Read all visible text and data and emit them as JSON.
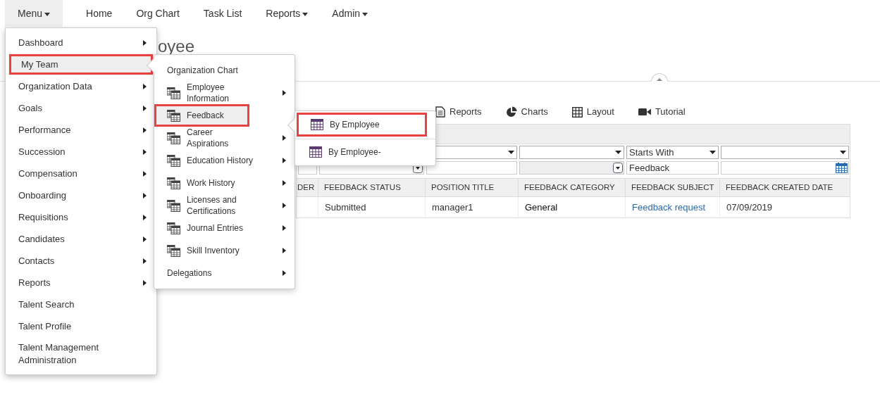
{
  "nav": [
    {
      "label": "Menu",
      "dropdown": true,
      "selected": true
    },
    {
      "label": "Home",
      "dropdown": false,
      "selected": false
    },
    {
      "label": "Org Chart",
      "dropdown": false,
      "selected": false
    },
    {
      "label": "Task List",
      "dropdown": false,
      "selected": false
    },
    {
      "label": "Reports",
      "dropdown": true,
      "selected": false
    },
    {
      "label": "Admin",
      "dropdown": true,
      "selected": false
    }
  ],
  "page_title": "oyee",
  "toolbar": [
    {
      "kind": "reports",
      "label": "Reports"
    },
    {
      "kind": "charts",
      "label": "Charts"
    },
    {
      "kind": "layout",
      "label": "Layout"
    },
    {
      "kind": "tutorial",
      "label": "Tutorial"
    }
  ],
  "grid": {
    "filter_selects": [
      {
        "kind": "dropdown"
      },
      {
        "kind": "dropdown"
      },
      {
        "kind": "dropdown",
        "value": "Starts With"
      },
      {
        "kind": "dropdown"
      }
    ],
    "filter_inputs": [
      {
        "kind": "text"
      },
      {
        "kind": "select"
      },
      {
        "kind": "text"
      },
      {
        "kind": "disabled-select"
      },
      {
        "kind": "text",
        "value": "Feedback"
      },
      {
        "kind": "date"
      }
    ],
    "columns": [
      "DER",
      "FEEDBACK STATUS",
      "POSITION TITLE",
      "FEEDBACK CATEGORY",
      "FEEDBACK SUBJECT",
      "FEEDBACK CREATED DATE"
    ],
    "rows": [
      [
        {
          "kind": "empty"
        },
        {
          "kind": "text",
          "text": "Submitted"
        },
        {
          "kind": "text",
          "text": "manager1"
        },
        {
          "kind": "strong",
          "text": "General"
        },
        {
          "kind": "link",
          "text": "Feedback request"
        },
        {
          "kind": "text",
          "text": "07/09/2019"
        }
      ]
    ]
  },
  "main_menu": [
    {
      "label": "Dashboard",
      "has_submenu": true,
      "selected": false,
      "highlighted": false
    },
    {
      "label": "My Team",
      "has_submenu": false,
      "selected": true,
      "highlighted": true
    },
    {
      "label": "Organization Data",
      "has_submenu": true,
      "selected": false,
      "highlighted": false
    },
    {
      "label": "Goals",
      "has_submenu": true,
      "selected": false,
      "highlighted": false
    },
    {
      "label": "Performance",
      "has_submenu": true,
      "selected": false,
      "highlighted": false
    },
    {
      "label": "Succession",
      "has_submenu": true,
      "selected": false,
      "highlighted": false
    },
    {
      "label": "Compensation",
      "has_submenu": true,
      "selected": false,
      "highlighted": false
    },
    {
      "label": "Onboarding",
      "has_submenu": true,
      "selected": false,
      "highlighted": false
    },
    {
      "label": "Requisitions",
      "has_submenu": true,
      "selected": false,
      "highlighted": false
    },
    {
      "label": "Candidates",
      "has_submenu": true,
      "selected": false,
      "highlighted": false
    },
    {
      "label": "Contacts",
      "has_submenu": true,
      "selected": false,
      "highlighted": false
    },
    {
      "label": "Reports",
      "has_submenu": true,
      "selected": false,
      "highlighted": false
    },
    {
      "label": "Talent Search",
      "has_submenu": false,
      "selected": false,
      "highlighted": false
    },
    {
      "label": "Talent Profile",
      "has_submenu": false,
      "selected": false,
      "highlighted": false
    },
    {
      "label": "Talent Management Administration",
      "has_submenu": false,
      "selected": false,
      "highlighted": false
    }
  ],
  "team_menu": [
    {
      "kind": "plain",
      "label": "Organization Chart",
      "has_submenu": false,
      "selected": false,
      "highlighted": false
    },
    {
      "kind": "grid",
      "label": "Employee Information",
      "has_submenu": true,
      "selected": false,
      "highlighted": false
    },
    {
      "kind": "grid",
      "label": "Feedback",
      "has_submenu": false,
      "selected": true,
      "highlighted": true
    },
    {
      "kind": "grid",
      "label": "Career Aspirations",
      "has_submenu": true,
      "selected": false,
      "highlighted": false
    },
    {
      "kind": "grid",
      "label": "Education History",
      "has_submenu": true,
      "selected": false,
      "highlighted": false
    },
    {
      "kind": "grid",
      "label": "Work History",
      "has_submenu": true,
      "selected": false,
      "highlighted": false
    },
    {
      "kind": "grid",
      "label": "Licenses and Certifications",
      "has_submenu": true,
      "selected": false,
      "highlighted": false
    },
    {
      "kind": "grid",
      "label": "Journal Entries",
      "has_submenu": true,
      "selected": false,
      "highlighted": false
    },
    {
      "kind": "grid",
      "label": "Skill Inventory",
      "has_submenu": true,
      "selected": false,
      "highlighted": false
    },
    {
      "kind": "plain",
      "label": "Delegations",
      "has_submenu": true,
      "selected": false,
      "highlighted": false
    }
  ],
  "feedback_menu": [
    {
      "label": "By Employee",
      "highlighted": true
    },
    {
      "label": "By Employee-",
      "highlighted": false
    }
  ]
}
